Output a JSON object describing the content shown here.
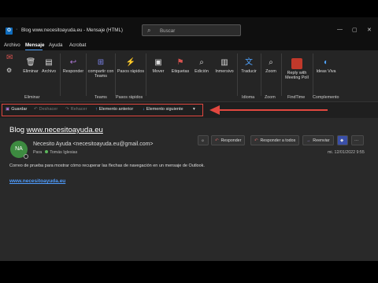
{
  "window": {
    "title": "Blog www.necesitoayuda.eu  -  Mensaje (HTML)",
    "search_placeholder": "Buscar",
    "app_icon_letter": "O"
  },
  "menu": {
    "items": [
      "Archivo",
      "Mensaje",
      "Ayuda",
      "Acrobat"
    ],
    "active": "Mensaje"
  },
  "ribbon": {
    "delete_btn": "Eliminar",
    "archive_btn": "Archivo",
    "delete_group": "Eliminar",
    "respond_btn": "Responder",
    "teams_btn": "compartir con Teams",
    "teams_group": "Teams",
    "quicksteps_btn": "Pasos rápidos",
    "quicksteps_group": "Pasos rápidos",
    "move_btn": "Mover",
    "tags_btn": "Etiquetas",
    "edit_btn": "Edición",
    "immersive_btn": "Inmersivo",
    "translate_btn": "Traducir",
    "language_group": "Idioma",
    "zoom_btn": "Zoom",
    "zoom_group": "Zoom",
    "reply_meeting_btn": "Reply with Meeting Poll",
    "findtime_group": "FindTime",
    "ideas_btn": "Ideas Viva",
    "complement_group": "Complemento"
  },
  "quick_toolbar": {
    "save": "Guardar",
    "undo": "Deshacer",
    "redo": "Rehacer",
    "prev": "Elemento anterior",
    "next": "Elemento siguiente"
  },
  "message": {
    "subject_prefix": "Blog ",
    "subject_link": "www.necesitoayuda.eu",
    "avatar_initials": "NA",
    "sender": "Necesito Ayuda <necesitoayuda.eu@gmail.com>",
    "to_label": "Para",
    "to_name": "Tomás Iglesias",
    "date": "mi. 12/01/2022 9:55",
    "body": "Correo de prueba para mostrar cómo recuperar las flechas de navegación en un mensaje de Outlook.",
    "link": "www.necesitoayuda.eu"
  },
  "actions": {
    "reply": "Responder",
    "reply_all": "Responder a todos",
    "forward": "Reenviar"
  },
  "colors": {
    "highlight": "#e2473f",
    "accent": "#4fa3ff",
    "avatar": "#3d8b40"
  }
}
